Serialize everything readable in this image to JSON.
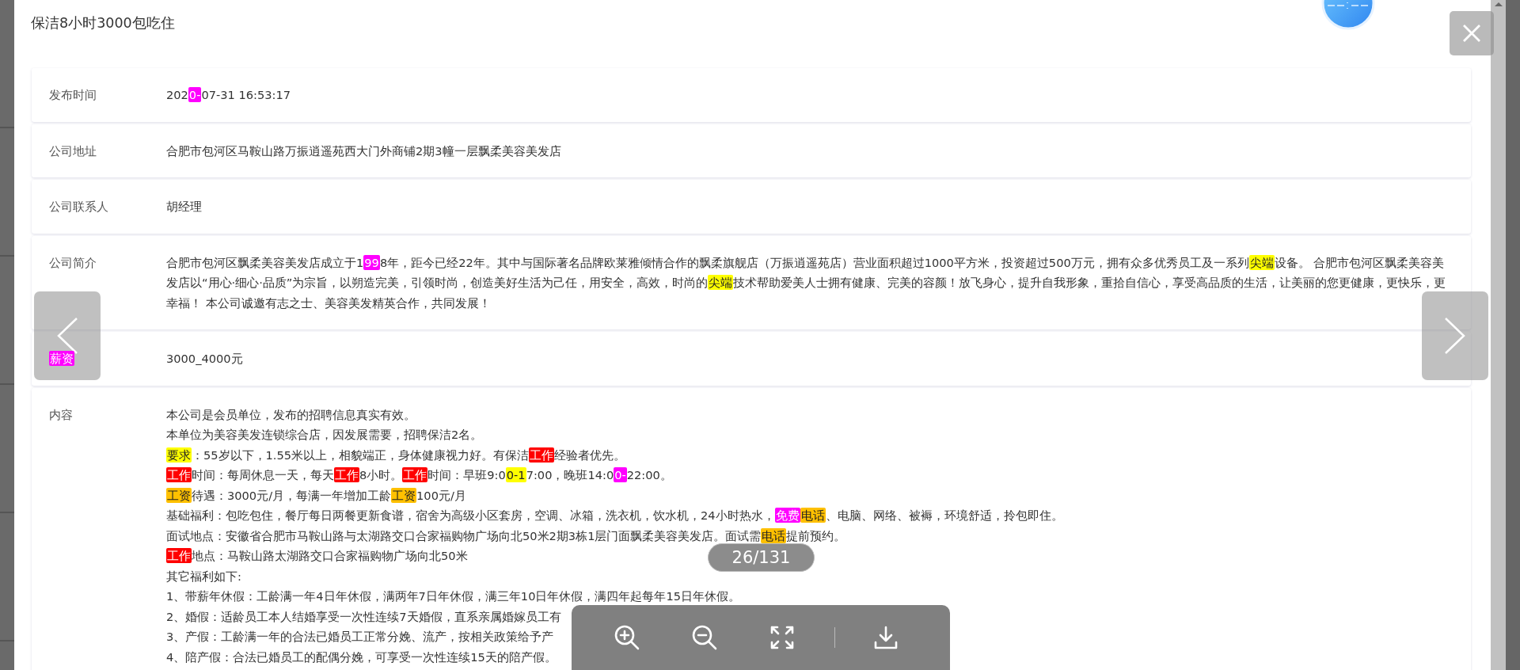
{
  "dialog": {
    "title": "保洁8小时3000包吃住",
    "rows": [
      {
        "label": [
          {
            "text": "发布时间"
          }
        ],
        "lines": [
          [
            {
              "text": "202"
            },
            {
              "text": "0-",
              "color": "#ff00ff"
            },
            {
              "text": "07-31 16:53:17"
            }
          ]
        ]
      },
      {
        "label": [
          {
            "text": "公司地址"
          }
        ],
        "lines": [
          [
            {
              "text": "合肥市包河区马鞍山路万振逍遥苑西大门外商铺2期3幢一层飘柔美容美发店"
            }
          ]
        ]
      },
      {
        "label": [
          {
            "text": "公司联系人"
          }
        ],
        "lines": [
          [
            {
              "text": "胡经理"
            }
          ]
        ]
      },
      {
        "label": [
          {
            "text": "公司简介"
          }
        ],
        "lines": [
          [
            {
              "text": "合肥市包河区飘柔美容美发店成立于1"
            },
            {
              "text": "99",
              "color": "#ff00ff"
            },
            {
              "text": "8年，距今已经22年。其中与国际著名品牌欧莱雅倾情合作的飘柔旗舰店（万振逍遥苑店）营业面积超过1000平方米，投资超过500万元，拥有众多优秀员工及一系列"
            },
            {
              "text": "尖端",
              "color": "#ffff00"
            },
            {
              "text": "设备。 合肥市包河区飘柔美容美发店以“用心·细心·品质”为宗旨，以朔造完美，引领时尚，创造美好生活为己任，用安全，高效，时尚的"
            },
            {
              "text": "尖端",
              "color": "#ffff00"
            },
            {
              "text": "技术帮助爱美人士拥有健康、完美的容颜！放飞身心，提升自我形象，重拾自信心，享受高品质的生活，让美丽的您更健康，更快乐，更幸福！ 本公司诚邀有志之士、美容美发精英合作，共同发展！"
            }
          ]
        ]
      },
      {
        "label": [
          {
            "text": "薪资",
            "color": "#ff00ff"
          }
        ],
        "lines": [
          [
            {
              "text": "3000_4000元"
            }
          ]
        ]
      },
      {
        "label": [
          {
            "text": "内容"
          }
        ],
        "lines": [
          [
            {
              "text": "本公司是会员单位，发布的招聘信息真实有效。"
            }
          ],
          [
            {
              "text": "本单位为美容美发连锁综合店，因发展需要，招聘保洁2名。"
            }
          ],
          [
            {
              "text": "要求",
              "color": "#ffff00"
            },
            {
              "text": "：55岁以下，1.55米以上，相貌端正，身体健康视力好。有保洁"
            },
            {
              "text": "工作",
              "color": "#ff0000"
            },
            {
              "text": "经验者优先。"
            }
          ],
          [
            {
              "text": "工作",
              "color": "#ff0000"
            },
            {
              "text": "时间：每周休息一天，每天"
            },
            {
              "text": "工作",
              "color": "#ff0000"
            },
            {
              "text": "8小时。"
            },
            {
              "text": "工作",
              "color": "#ff0000"
            },
            {
              "text": "时间：早班9:0"
            },
            {
              "text": "0-1",
              "color": "#ffff00"
            },
            {
              "text": "7:00，晚班14:0"
            },
            {
              "text": "0-",
              "color": "#ff00ff"
            },
            {
              "text": "22:00。"
            }
          ],
          [
            {
              "text": "工资",
              "color": "#ffc000"
            },
            {
              "text": "待遇：3000元/月，每满一年增加工龄"
            },
            {
              "text": "工资",
              "color": "#ffc000"
            },
            {
              "text": "100元/月"
            }
          ],
          [
            {
              "text": "基础福利：包吃包住，餐厅每日两餐更新食谱，宿舍为高级小区套房，空调、冰箱，洗衣机，饮水机，24小时热水，"
            },
            {
              "text": "免费",
              "color": "#ff00ff"
            },
            {
              "text": "电话",
              "color": "#ffc000"
            },
            {
              "text": "、电脑、网络、被褥，环境舒适，拎包即住。"
            }
          ],
          [
            {
              "text": "面试地点：安徽省合肥市马鞍山路与太湖路交口合家福购物广场向北50米2期3栋1层门面飘柔美容美发店。面试需"
            },
            {
              "text": "电话",
              "color": "#ffc000"
            },
            {
              "text": "提前预约。"
            }
          ],
          [
            {
              "text": "工作",
              "color": "#ff0000"
            },
            {
              "text": "地点：马鞍山路太湖路交口合家福购物广场向北50米"
            }
          ],
          [
            {
              "text": "其它福利如下:"
            }
          ],
          [
            {
              "text": "1、带薪年休假：工龄满一年4日年休假，满两年7日年休假，满三年10日年休假，满四年起每年15日年休假。"
            }
          ],
          [
            {
              "text": "2、婚假：适龄员工本人结婚享受一次性连续7天婚假，直系亲属婚嫁员工有"
            }
          ],
          [
            {
              "text": "3、产假：工龄满一年的合法已婚员工正常分娩、流产，按相关政策给予产"
            }
          ],
          [
            {
              "text": "4、陪产假：合法已婚员工的配偶分娩，可享受一次性连续15天的陪产假。"
            }
          ]
        ]
      }
    ]
  },
  "viewer": {
    "counter": "26/131"
  }
}
